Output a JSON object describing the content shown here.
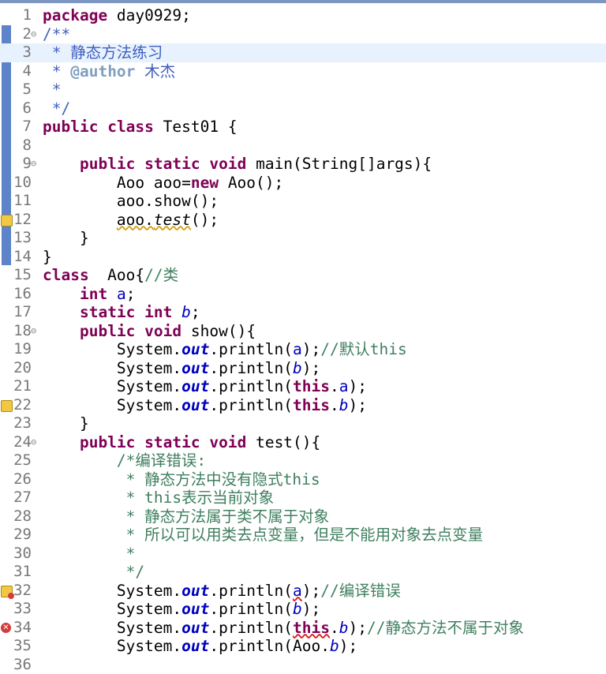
{
  "editor": {
    "lines": [
      {
        "n": "1",
        "segs": [
          {
            "t": "package",
            "c": "kw"
          },
          {
            "t": " day0929;"
          }
        ]
      },
      {
        "n": "2",
        "fold": true,
        "segs": [
          {
            "t": "/**",
            "c": "jd"
          }
        ]
      },
      {
        "n": "3",
        "current": true,
        "segs": [
          {
            "t": " * 静态方法练习",
            "c": "jd"
          }
        ]
      },
      {
        "n": "4",
        "segs": [
          {
            "t": " * ",
            "c": "jd"
          },
          {
            "t": "@author",
            "c": "tag"
          },
          {
            "t": " 木杰",
            "c": "jd"
          }
        ]
      },
      {
        "n": "5",
        "segs": [
          {
            "t": " *",
            "c": "jd"
          }
        ]
      },
      {
        "n": "6",
        "segs": [
          {
            "t": " */",
            "c": "jd"
          }
        ]
      },
      {
        "n": "7",
        "segs": [
          {
            "t": "public",
            "c": "kw"
          },
          {
            "t": " "
          },
          {
            "t": "class",
            "c": "kw"
          },
          {
            "t": " Test01 {"
          }
        ]
      },
      {
        "n": "8",
        "segs": []
      },
      {
        "n": "9",
        "fold": true,
        "segs": [
          {
            "t": "    "
          },
          {
            "t": "public",
            "c": "kw"
          },
          {
            "t": " "
          },
          {
            "t": "static",
            "c": "kw"
          },
          {
            "t": " "
          },
          {
            "t": "void",
            "c": "kw"
          },
          {
            "t": " main(String[]args){"
          }
        ]
      },
      {
        "n": "10",
        "segs": [
          {
            "t": "        Aoo aoo="
          },
          {
            "t": "new",
            "c": "kw"
          },
          {
            "t": " Aoo();"
          }
        ]
      },
      {
        "n": "11",
        "segs": [
          {
            "t": "        aoo.show();"
          }
        ]
      },
      {
        "n": "12",
        "marker": "warn",
        "segs": [
          {
            "t": "        "
          },
          {
            "t": "aoo.",
            "c": "wavy-w"
          },
          {
            "t": "test",
            "c": "smeth wavy-w"
          },
          {
            "t": "();"
          }
        ]
      },
      {
        "n": "13",
        "segs": [
          {
            "t": "    }"
          }
        ]
      },
      {
        "n": "14",
        "segs": [
          {
            "t": "}"
          }
        ]
      },
      {
        "n": "15",
        "segs": [
          {
            "t": "class",
            "c": "kw"
          },
          {
            "t": "  Aoo{"
          },
          {
            "t": "//类",
            "c": "cm"
          }
        ]
      },
      {
        "n": "16",
        "segs": [
          {
            "t": "    "
          },
          {
            "t": "int",
            "c": "kw"
          },
          {
            "t": " "
          },
          {
            "t": "a",
            "c": "fld"
          },
          {
            "t": ";"
          }
        ]
      },
      {
        "n": "17",
        "segs": [
          {
            "t": "    "
          },
          {
            "t": "static",
            "c": "kw"
          },
          {
            "t": " "
          },
          {
            "t": "int",
            "c": "kw"
          },
          {
            "t": " "
          },
          {
            "t": "b",
            "c": "sfld2"
          },
          {
            "t": ";"
          }
        ]
      },
      {
        "n": "18",
        "fold": true,
        "segs": [
          {
            "t": "    "
          },
          {
            "t": "public",
            "c": "kw"
          },
          {
            "t": " "
          },
          {
            "t": "void",
            "c": "kw"
          },
          {
            "t": " show(){"
          }
        ]
      },
      {
        "n": "19",
        "segs": [
          {
            "t": "        System."
          },
          {
            "t": "out",
            "c": "sfld"
          },
          {
            "t": ".println("
          },
          {
            "t": "a",
            "c": "fld"
          },
          {
            "t": ");"
          },
          {
            "t": "//默认this",
            "c": "cm"
          }
        ]
      },
      {
        "n": "20",
        "segs": [
          {
            "t": "        System."
          },
          {
            "t": "out",
            "c": "sfld"
          },
          {
            "t": ".println("
          },
          {
            "t": "b",
            "c": "sfld2"
          },
          {
            "t": ");"
          }
        ]
      },
      {
        "n": "21",
        "segs": [
          {
            "t": "        System."
          },
          {
            "t": "out",
            "c": "sfld"
          },
          {
            "t": ".println("
          },
          {
            "t": "this",
            "c": "kw"
          },
          {
            "t": "."
          },
          {
            "t": "a",
            "c": "fld"
          },
          {
            "t": ");"
          }
        ]
      },
      {
        "n": "22",
        "marker": "warn",
        "segs": [
          {
            "t": "        System."
          },
          {
            "t": "out",
            "c": "sfld"
          },
          {
            "t": ".println("
          },
          {
            "t": "this",
            "c": "kw"
          },
          {
            "t": "."
          },
          {
            "t": "b",
            "c": "sfld2"
          },
          {
            "t": ");"
          }
        ]
      },
      {
        "n": "23",
        "segs": [
          {
            "t": "    }"
          }
        ]
      },
      {
        "n": "24",
        "fold": true,
        "segs": [
          {
            "t": "    "
          },
          {
            "t": "public",
            "c": "kw"
          },
          {
            "t": " "
          },
          {
            "t": "static",
            "c": "kw"
          },
          {
            "t": " "
          },
          {
            "t": "void",
            "c": "kw"
          },
          {
            "t": " test(){"
          }
        ]
      },
      {
        "n": "25",
        "segs": [
          {
            "t": "        /*编译错误:",
            "c": "cm"
          }
        ]
      },
      {
        "n": "26",
        "segs": [
          {
            "t": "         * 静态方法中没有隐式this",
            "c": "cm"
          }
        ]
      },
      {
        "n": "27",
        "segs": [
          {
            "t": "         * this表示当前对象",
            "c": "cm"
          }
        ]
      },
      {
        "n": "28",
        "segs": [
          {
            "t": "         * 静态方法属于类不属于对象",
            "c": "cm"
          }
        ]
      },
      {
        "n": "29",
        "segs": [
          {
            "t": "         * 所以可以用类去点变量，但是不能用对象去点变量",
            "c": "cm"
          }
        ]
      },
      {
        "n": "30",
        "segs": [
          {
            "t": "         *",
            "c": "cm"
          }
        ]
      },
      {
        "n": "31",
        "segs": [
          {
            "t": "         */",
            "c": "cm"
          }
        ]
      },
      {
        "n": "32",
        "marker": "errwarn",
        "segs": [
          {
            "t": "        System."
          },
          {
            "t": "out",
            "c": "sfld"
          },
          {
            "t": ".println("
          },
          {
            "t": "a",
            "c": "fld wavy-e"
          },
          {
            "t": ");"
          },
          {
            "t": "//编译错误",
            "c": "cm"
          }
        ]
      },
      {
        "n": "33",
        "segs": [
          {
            "t": "        System."
          },
          {
            "t": "out",
            "c": "sfld"
          },
          {
            "t": ".println("
          },
          {
            "t": "b",
            "c": "sfld2"
          },
          {
            "t": ");"
          }
        ]
      },
      {
        "n": "34",
        "marker": "err",
        "segs": [
          {
            "t": "        System."
          },
          {
            "t": "out",
            "c": "sfld"
          },
          {
            "t": ".println("
          },
          {
            "t": "this",
            "c": "kw wavy-e"
          },
          {
            "t": "."
          },
          {
            "t": "b",
            "c": "sfld2"
          },
          {
            "t": ");"
          },
          {
            "t": "//静态方法不属于对象",
            "c": "cm"
          }
        ]
      },
      {
        "n": "35",
        "segs": [
          {
            "t": "        System."
          },
          {
            "t": "out",
            "c": "sfld"
          },
          {
            "t": ".println(Aoo."
          },
          {
            "t": "b",
            "c": "sfld2"
          },
          {
            "t": ");"
          }
        ]
      },
      {
        "n": "36",
        "segs": []
      }
    ]
  }
}
